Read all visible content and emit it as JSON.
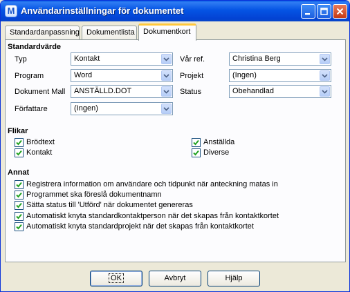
{
  "window": {
    "title": "Användarinställningar för dokumentet"
  },
  "tabs": [
    {
      "label": "Standardanpassning"
    },
    {
      "label": "Dokumentlista"
    },
    {
      "label": "Dokumentkort"
    }
  ],
  "standard": {
    "heading": "Standardvärde",
    "typ": {
      "label": "Typ",
      "value": "Kontakt"
    },
    "program": {
      "label": "Program",
      "value": "Word"
    },
    "mall": {
      "label": "Dokument Mall",
      "value": "ANSTÄLLD.DOT"
    },
    "forfattare": {
      "label": "Författare",
      "value": "(Ingen)"
    },
    "var_ref": {
      "label": "Vår ref.",
      "value": "Christina Berg"
    },
    "projekt": {
      "label": "Projekt",
      "value": "(Ingen)"
    },
    "status": {
      "label": "Status",
      "value": "Obehandlad"
    }
  },
  "flikar": {
    "heading": "Flikar",
    "items": [
      {
        "label": "Brödtext",
        "checked": true
      },
      {
        "label": "Kontakt",
        "checked": true
      },
      {
        "label": "Anställda",
        "checked": true
      },
      {
        "label": "Diverse",
        "checked": true
      }
    ]
  },
  "annat": {
    "heading": "Annat",
    "items": [
      {
        "label": "Registrera information om användare och tidpunkt när anteckning matas in",
        "checked": true
      },
      {
        "label": "Programmet ska föreslå dokumentnamn",
        "checked": true
      },
      {
        "label": "Sätta status till 'Utförd' när dokumentet genereras",
        "checked": true
      },
      {
        "label": "Automatiskt knyta standardkontaktperson när det skapas från kontaktkortet",
        "checked": true
      },
      {
        "label": "Automatiskt knyta standardprojekt när det skapas från kontaktkortet",
        "checked": true
      }
    ]
  },
  "buttons": {
    "ok": "OK",
    "cancel": "Avbryt",
    "help": "Hjälp"
  }
}
